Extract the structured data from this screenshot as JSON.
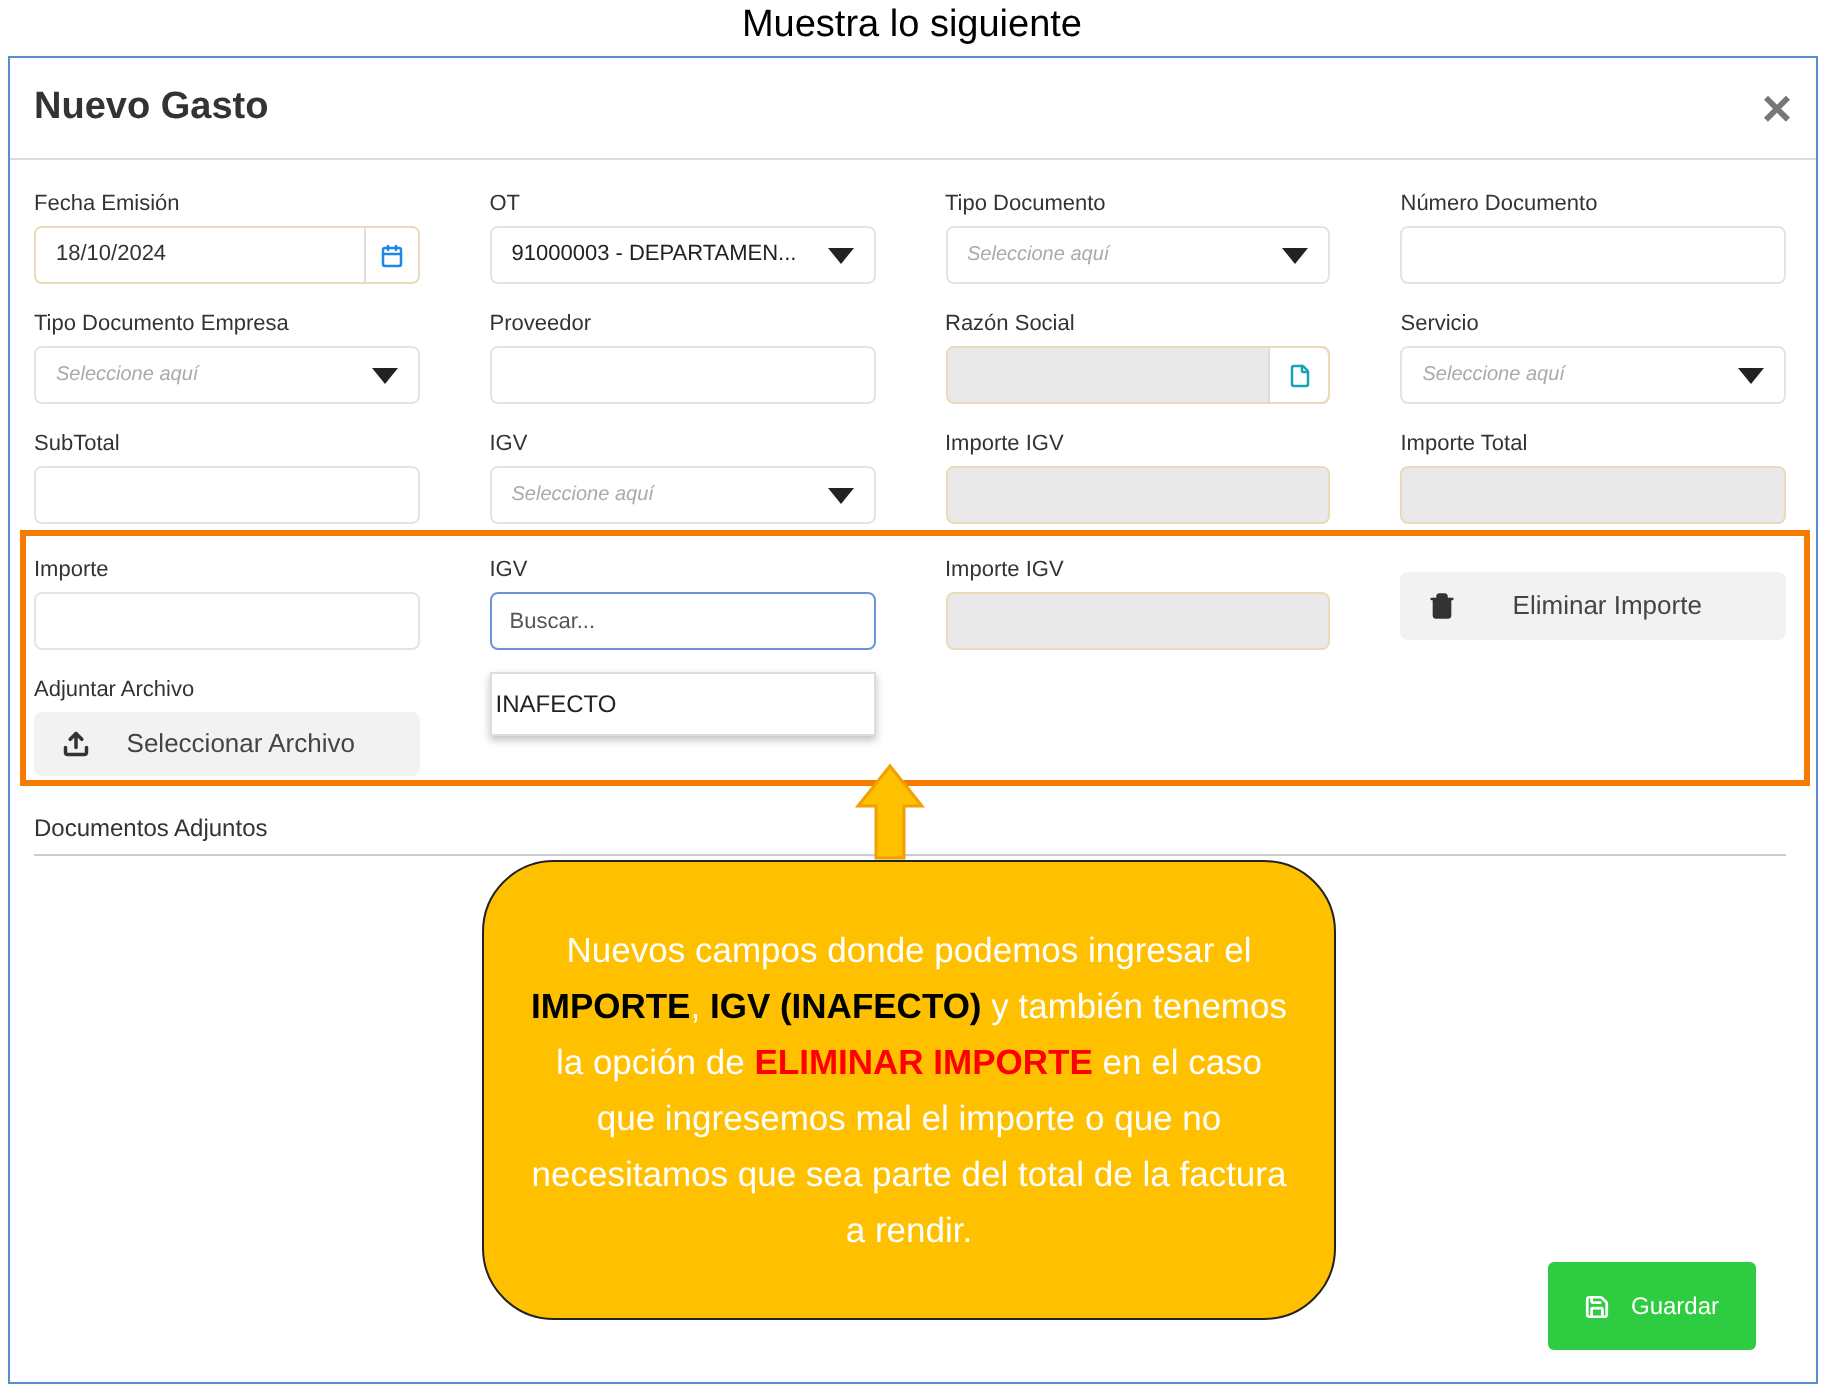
{
  "caption": "Muestra lo siguiente",
  "dialog": {
    "title": "Nuevo Gasto",
    "close": "×"
  },
  "fields": [
    {
      "label": "Fecha Emisión",
      "kind": "date",
      "value": "18/10/2024"
    },
    {
      "label": "OT",
      "kind": "select",
      "value": "91000003 - DEPARTAMEN..."
    },
    {
      "label": "Tipo Documento",
      "kind": "select",
      "placeholder": "Seleccione aquí"
    },
    {
      "label": "Número Documento",
      "kind": "text"
    },
    {
      "label": "Tipo Documento Empresa",
      "kind": "select",
      "placeholder": "Seleccione aquí"
    },
    {
      "label": "Proveedor",
      "kind": "text"
    },
    {
      "label": "Razón Social",
      "kind": "readonly-file"
    },
    {
      "label": "Servicio",
      "kind": "select",
      "placeholder": "Seleccione aquí"
    },
    {
      "label": "SubTotal",
      "kind": "text"
    },
    {
      "label": "IGV",
      "kind": "select",
      "placeholder": "Seleccione aquí"
    },
    {
      "label": "Importe IGV",
      "kind": "readonly"
    },
    {
      "label": "Importe Total",
      "kind": "readonly"
    }
  ],
  "highlighted_section": {
    "fields": [
      {
        "label": "Importe",
        "kind": "text"
      },
      {
        "label": "IGV",
        "kind": "search",
        "placeholder": "Buscar...",
        "options": [
          "INAFECTO"
        ]
      },
      {
        "label": "Importe IGV",
        "kind": "readonly"
      },
      {
        "kind": "delete-button",
        "label": "Eliminar Importe"
      }
    ],
    "attachment": {
      "label": "Adjuntar Archivo",
      "button": "Seleccionar Archivo"
    }
  },
  "attachments_heading": "Documentos Adjuntos",
  "save_button": "Guardar",
  "callout": {
    "segments": [
      {
        "kind": "plain",
        "text": "Nuevos campos donde podemos ingresar el "
      },
      {
        "kind": "emphasis",
        "text": "IMPORTE"
      },
      {
        "kind": "plain",
        "text": ", "
      },
      {
        "kind": "emphasis",
        "text": "IGV (INAFECTO)"
      },
      {
        "kind": "plain",
        "text": " y también tenemos la opción de "
      },
      {
        "kind": "warning",
        "text": "ELIMINAR IMPORTE"
      },
      {
        "kind": "plain",
        "text": " en el caso que ingresemos mal el importe o que no necesitamos que sea parte del total de la factura a rendir."
      }
    ]
  }
}
